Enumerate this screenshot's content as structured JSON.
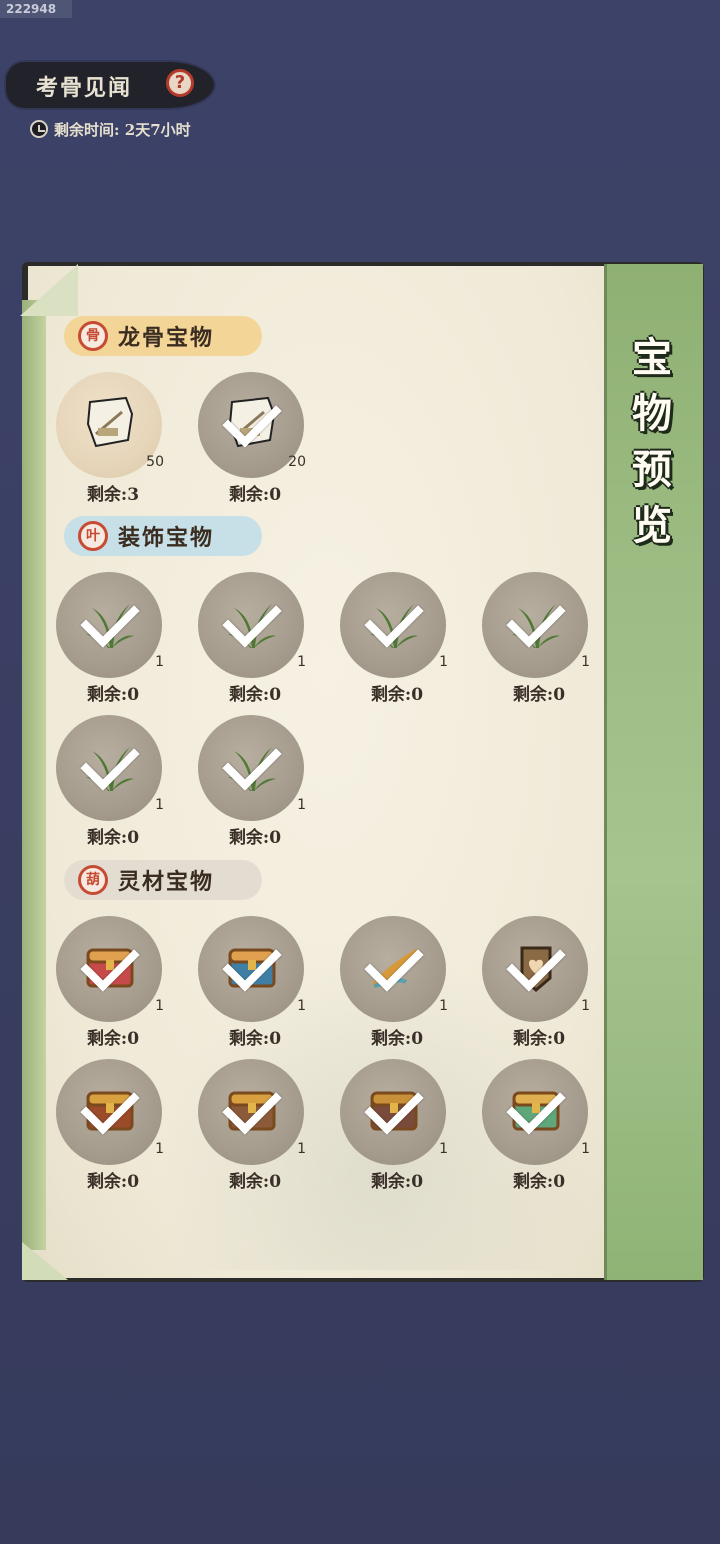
{
  "debug_id": "222948",
  "header": {
    "title": "考骨见闻",
    "help_icon": "question-icon",
    "timer_icon": "clock-icon",
    "timer_text": "剩余时间: 2天7小时"
  },
  "panel": {
    "side_title": [
      "宝",
      "物",
      "预",
      "览"
    ]
  },
  "sections": [
    {
      "label": "龙骨宝物",
      "icon": "dragon-bone-icon",
      "color": "#f3d597",
      "items": [
        {
          "count": "50",
          "remain": "剩余:3",
          "checked": false,
          "icon": "bone-scroll-icon"
        },
        {
          "count": "20",
          "remain": "剩余:0",
          "checked": true,
          "icon": "bone-scroll-icon"
        }
      ]
    },
    {
      "label": "装饰宝物",
      "icon": "leaf-icon",
      "color": "#c7dfe6",
      "items": [
        {
          "count": "1",
          "remain": "剩余:0",
          "checked": true,
          "icon": "fern-plant-icon"
        },
        {
          "count": "1",
          "remain": "剩余:0",
          "checked": true,
          "icon": "grass-plant-icon"
        },
        {
          "count": "1",
          "remain": "剩余:0",
          "checked": true,
          "icon": "grass-plant-icon"
        },
        {
          "count": "1",
          "remain": "剩余:0",
          "checked": true,
          "icon": "reed-plant-icon"
        },
        {
          "count": "1",
          "remain": "剩余:0",
          "checked": true,
          "icon": "fern-plant-icon"
        },
        {
          "count": "1",
          "remain": "剩余:0",
          "checked": true,
          "icon": "bamboo-plant-icon"
        }
      ]
    },
    {
      "label": "灵材宝物",
      "icon": "gourd-icon",
      "color": "#e2ddd0",
      "items": [
        {
          "count": "1",
          "remain": "剩余:0",
          "checked": true,
          "icon": "red-chest-icon"
        },
        {
          "count": "1",
          "remain": "剩余:0",
          "checked": true,
          "icon": "blue-chest-icon"
        },
        {
          "count": "1",
          "remain": "剩余:0",
          "checked": true,
          "icon": "feather-icon"
        },
        {
          "count": "1",
          "remain": "剩余:0",
          "checked": true,
          "icon": "heart-badge-icon"
        },
        {
          "count": "1",
          "remain": "剩余:0",
          "checked": true,
          "icon": "treasure-chest-icon"
        },
        {
          "count": "1",
          "remain": "剩余:0",
          "checked": true,
          "icon": "book-chest-icon"
        },
        {
          "count": "1",
          "remain": "剩余:0",
          "checked": true,
          "icon": "ore-chest-icon"
        },
        {
          "count": "1",
          "remain": "剩余:0",
          "checked": true,
          "icon": "green-chest-icon"
        }
      ]
    }
  ]
}
